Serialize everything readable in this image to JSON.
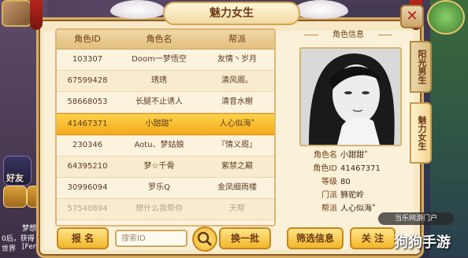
{
  "panel": {
    "title": "魅力女生"
  },
  "side_tabs": [
    {
      "label": "阳光男生",
      "active": false
    },
    {
      "label": "魅力女生",
      "active": true
    }
  ],
  "table": {
    "headers": [
      "角色ID",
      "角色名",
      "帮派"
    ],
    "rows": [
      {
        "id": "103307",
        "name": "Doom一梦悟空",
        "guild": "友情丶岁月"
      },
      {
        "id": "67599428",
        "name": "琇琇",
        "guild": "清风阁。"
      },
      {
        "id": "58668053",
        "name": "长腿不止诱人",
        "guild": "清音水榭"
      },
      {
        "id": "41467371",
        "name": "小甜甜˚",
        "guild": "人心似海˚",
        "selected": true
      },
      {
        "id": "230346",
        "name": "Aotu、梦姑娘",
        "guild": "『情义阁』"
      },
      {
        "id": "64395210",
        "name": "梦☆千骨",
        "guild": "紫禁之巅"
      },
      {
        "id": "30996094",
        "name": "罗乐Q",
        "guild": "金凤细雨楼"
      },
      {
        "id": "57540894",
        "name": "想什么我帮你",
        "guild": "天帮",
        "faded": true
      }
    ]
  },
  "info": {
    "title": "角色信息",
    "fields": [
      {
        "k": "角色名",
        "v": "小甜甜˚"
      },
      {
        "k": "角色ID",
        "v": "41467371"
      },
      {
        "k": "等级",
        "v": "80"
      },
      {
        "k": "门派",
        "v": "狮驼岭"
      },
      {
        "k": "帮派",
        "v": "人心似海˚"
      }
    ]
  },
  "buttons": {
    "report": "报 名",
    "search_placeholder": "搜索ID",
    "refresh": "换一批",
    "filter": "筛选信息",
    "follow": "关 注"
  },
  "hud": {
    "friend": "好友",
    "chat1": "梦想天",
    "chat2": "0后，获得",
    "chat3": "世界",
    "chat4": "[Fene"
  },
  "watermark": {
    "badge": "当乐网游门户",
    "text": "狗狗手游"
  },
  "colors": {
    "selected_row": "#f3a91c",
    "panel_bg": "#f7e8c6",
    "accent_brown": "#6b3a16"
  }
}
